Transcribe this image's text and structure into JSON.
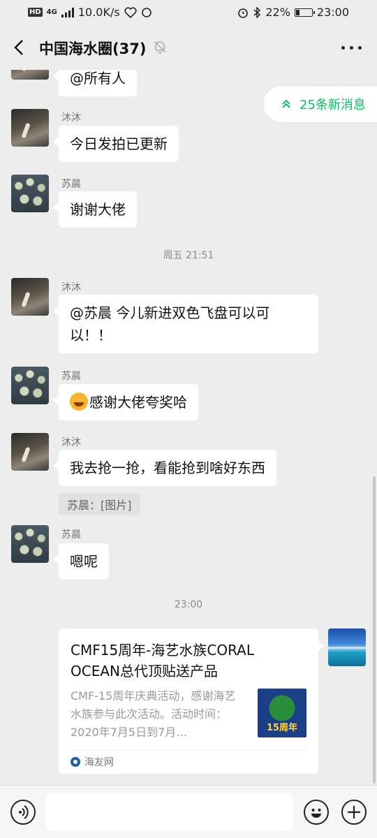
{
  "status_bar": {
    "network_badge": "HD",
    "network_type": "4G",
    "speed": "10.0K/s",
    "battery": "22%",
    "battery_level": 0.22,
    "time": "23:00"
  },
  "header": {
    "title": "中国海水圈(37)"
  },
  "new_messages": {
    "label": "25条新消息"
  },
  "messages": [
    {
      "sender": "",
      "text": "@所有人"
    },
    {
      "sender": "沐沐",
      "text": "今日发拍已更新"
    },
    {
      "sender": "苏晨",
      "text": "谢谢大佬"
    },
    {
      "sender": "沐沐",
      "text": "@苏晨  今儿新进双色飞盘可以可以！！"
    },
    {
      "sender": "苏晨",
      "text": "感谢大佬夸奖哈"
    },
    {
      "sender": "沐沐",
      "text": "我去抢一抢，看能抢到啥好东西",
      "quote": "苏晨：[图片]"
    },
    {
      "sender": "苏晨",
      "text": "嗯呢"
    }
  ],
  "timestamps": [
    "周五 21:51",
    "23:00"
  ],
  "link_card": {
    "title": "CMF15周年-海艺水族CORAL OCEAN总代顶贴送产品",
    "description": "CMF-15周年庆典活动，感谢海艺水族参与此次活动。活动时间：2020年7月5日到7月…",
    "thumb_text": "15周年",
    "source": "海友网"
  },
  "colors": {
    "background": "#ededed",
    "accent_green": "#07c160",
    "bubble": "#ffffff"
  }
}
